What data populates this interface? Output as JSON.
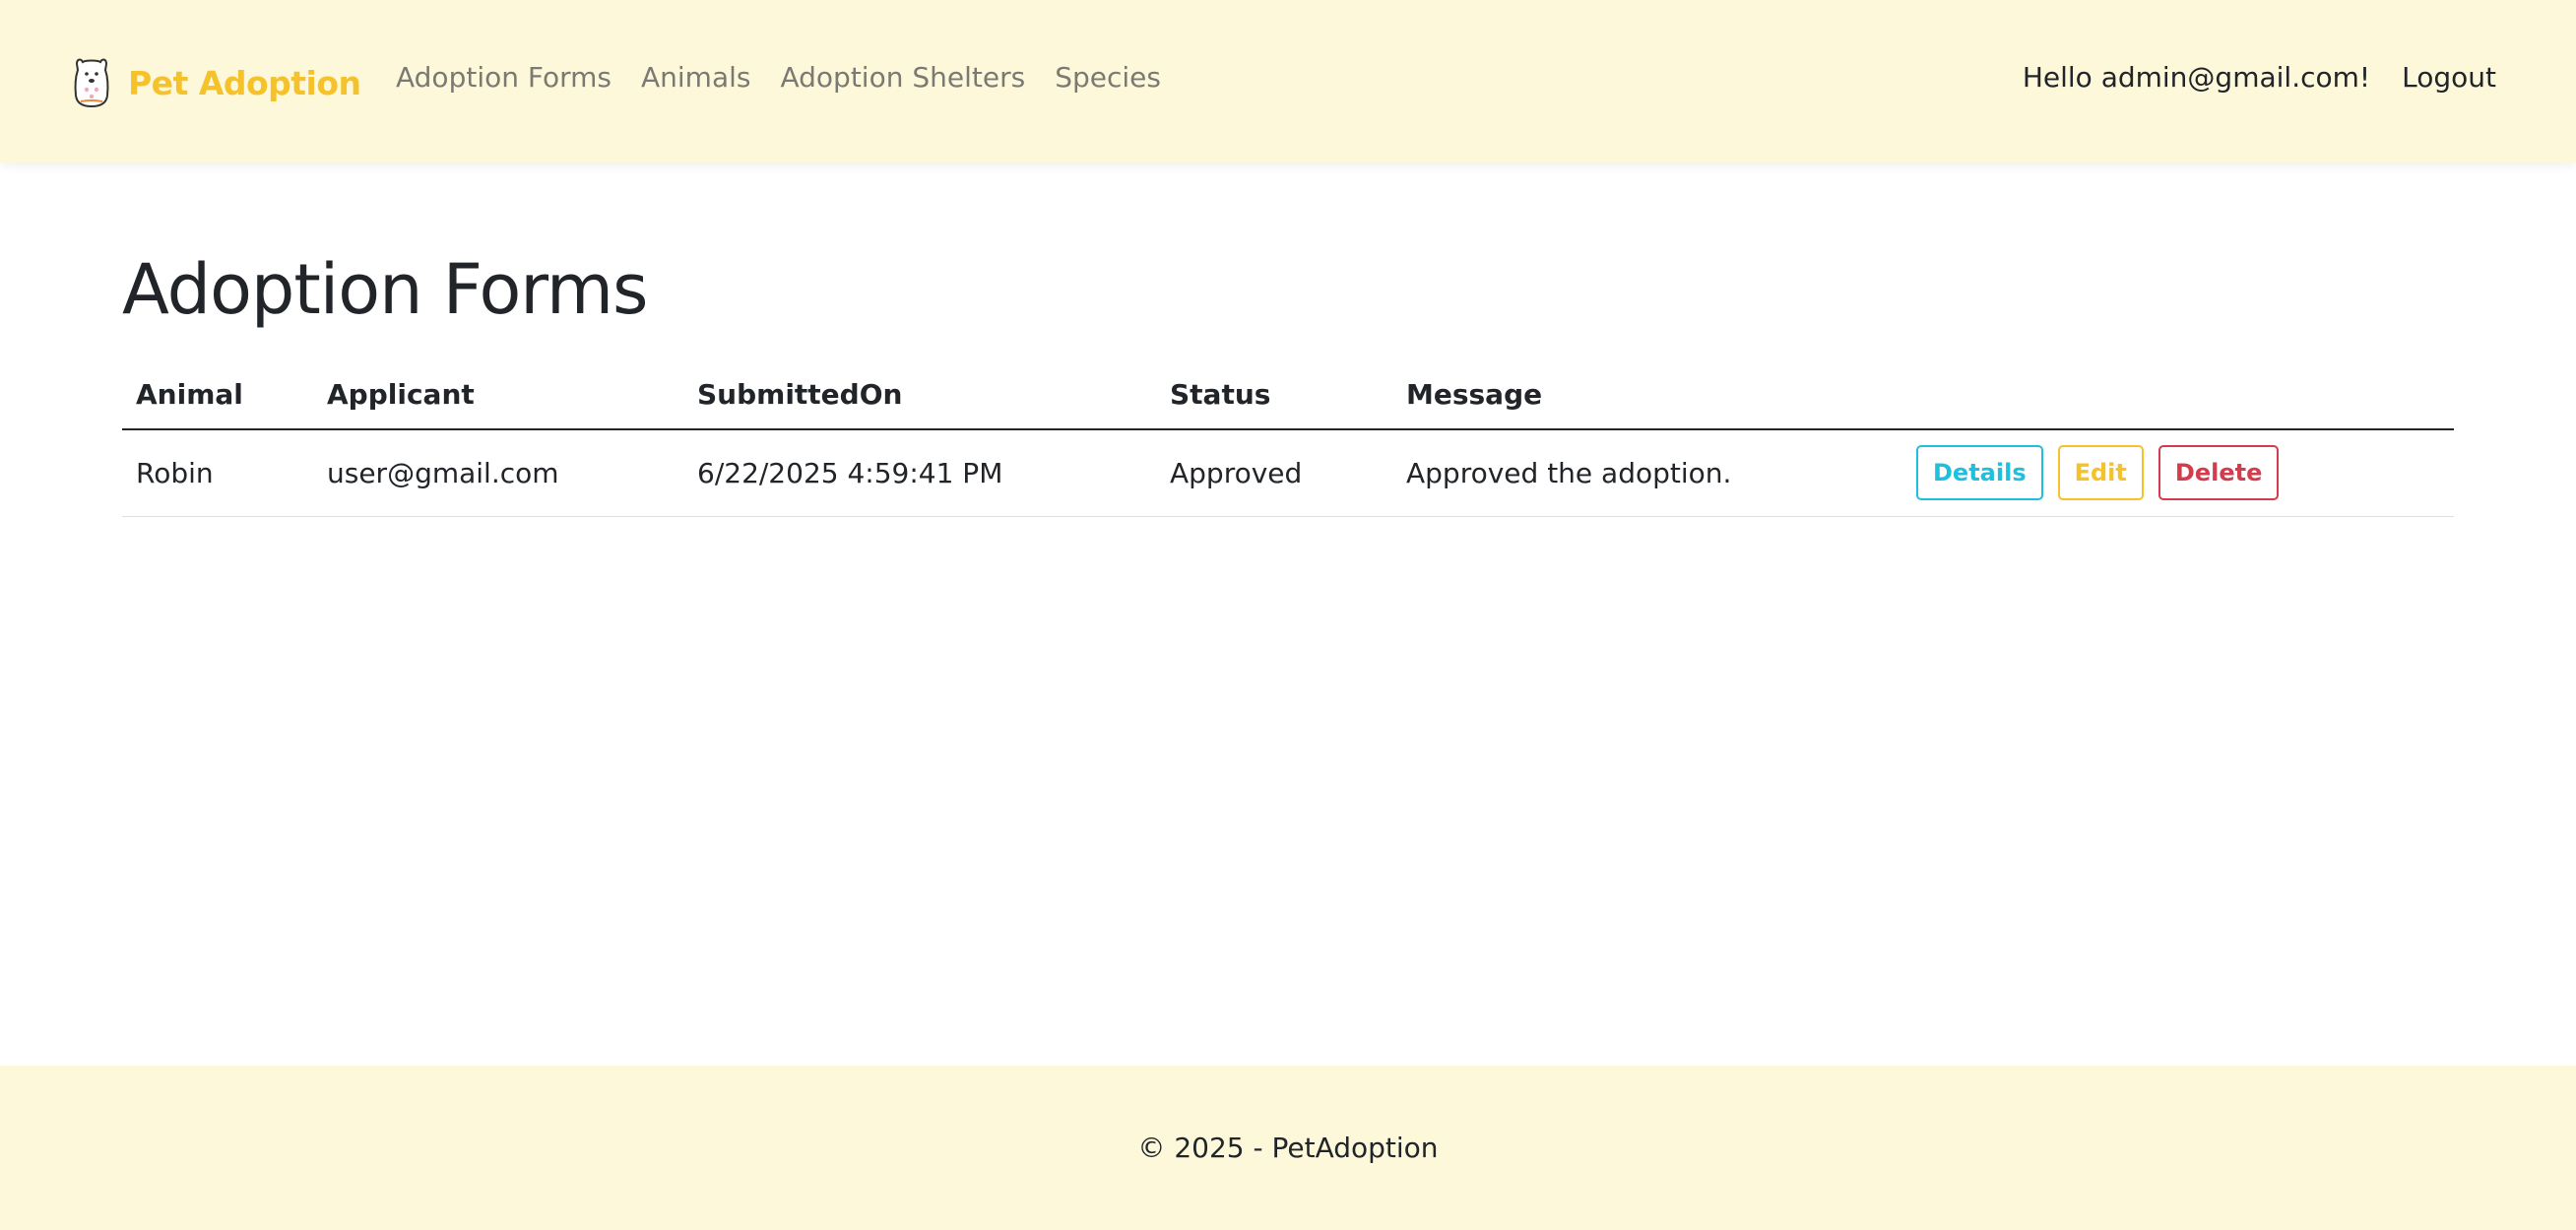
{
  "brand": {
    "name": "Pet Adoption",
    "icon": "dog-logo-icon"
  },
  "nav": {
    "links": [
      {
        "label": "Adoption Forms"
      },
      {
        "label": "Animals"
      },
      {
        "label": "Adoption Shelters"
      },
      {
        "label": "Species"
      }
    ],
    "greeting": "Hello admin@gmail.com!",
    "logout_label": "Logout"
  },
  "page": {
    "title": "Adoption Forms"
  },
  "table": {
    "headers": [
      "Animal",
      "Applicant",
      "SubmittedOn",
      "Status",
      "Message"
    ],
    "rows": [
      {
        "animal": "Robin",
        "applicant": "user@gmail.com",
        "submitted_on": "6/22/2025 4:59:41 PM",
        "status": "Approved",
        "message": "Approved the adoption.",
        "actions": {
          "details": "Details",
          "edit": "Edit",
          "delete": "Delete"
        }
      }
    ]
  },
  "footer": {
    "text": "© 2025 - PetAdoption"
  },
  "colors": {
    "header_bg": "#fef8db",
    "brand": "#f5c22b",
    "details": "#1ec0dd",
    "edit": "#f5c22b",
    "delete": "#d23c4d"
  }
}
